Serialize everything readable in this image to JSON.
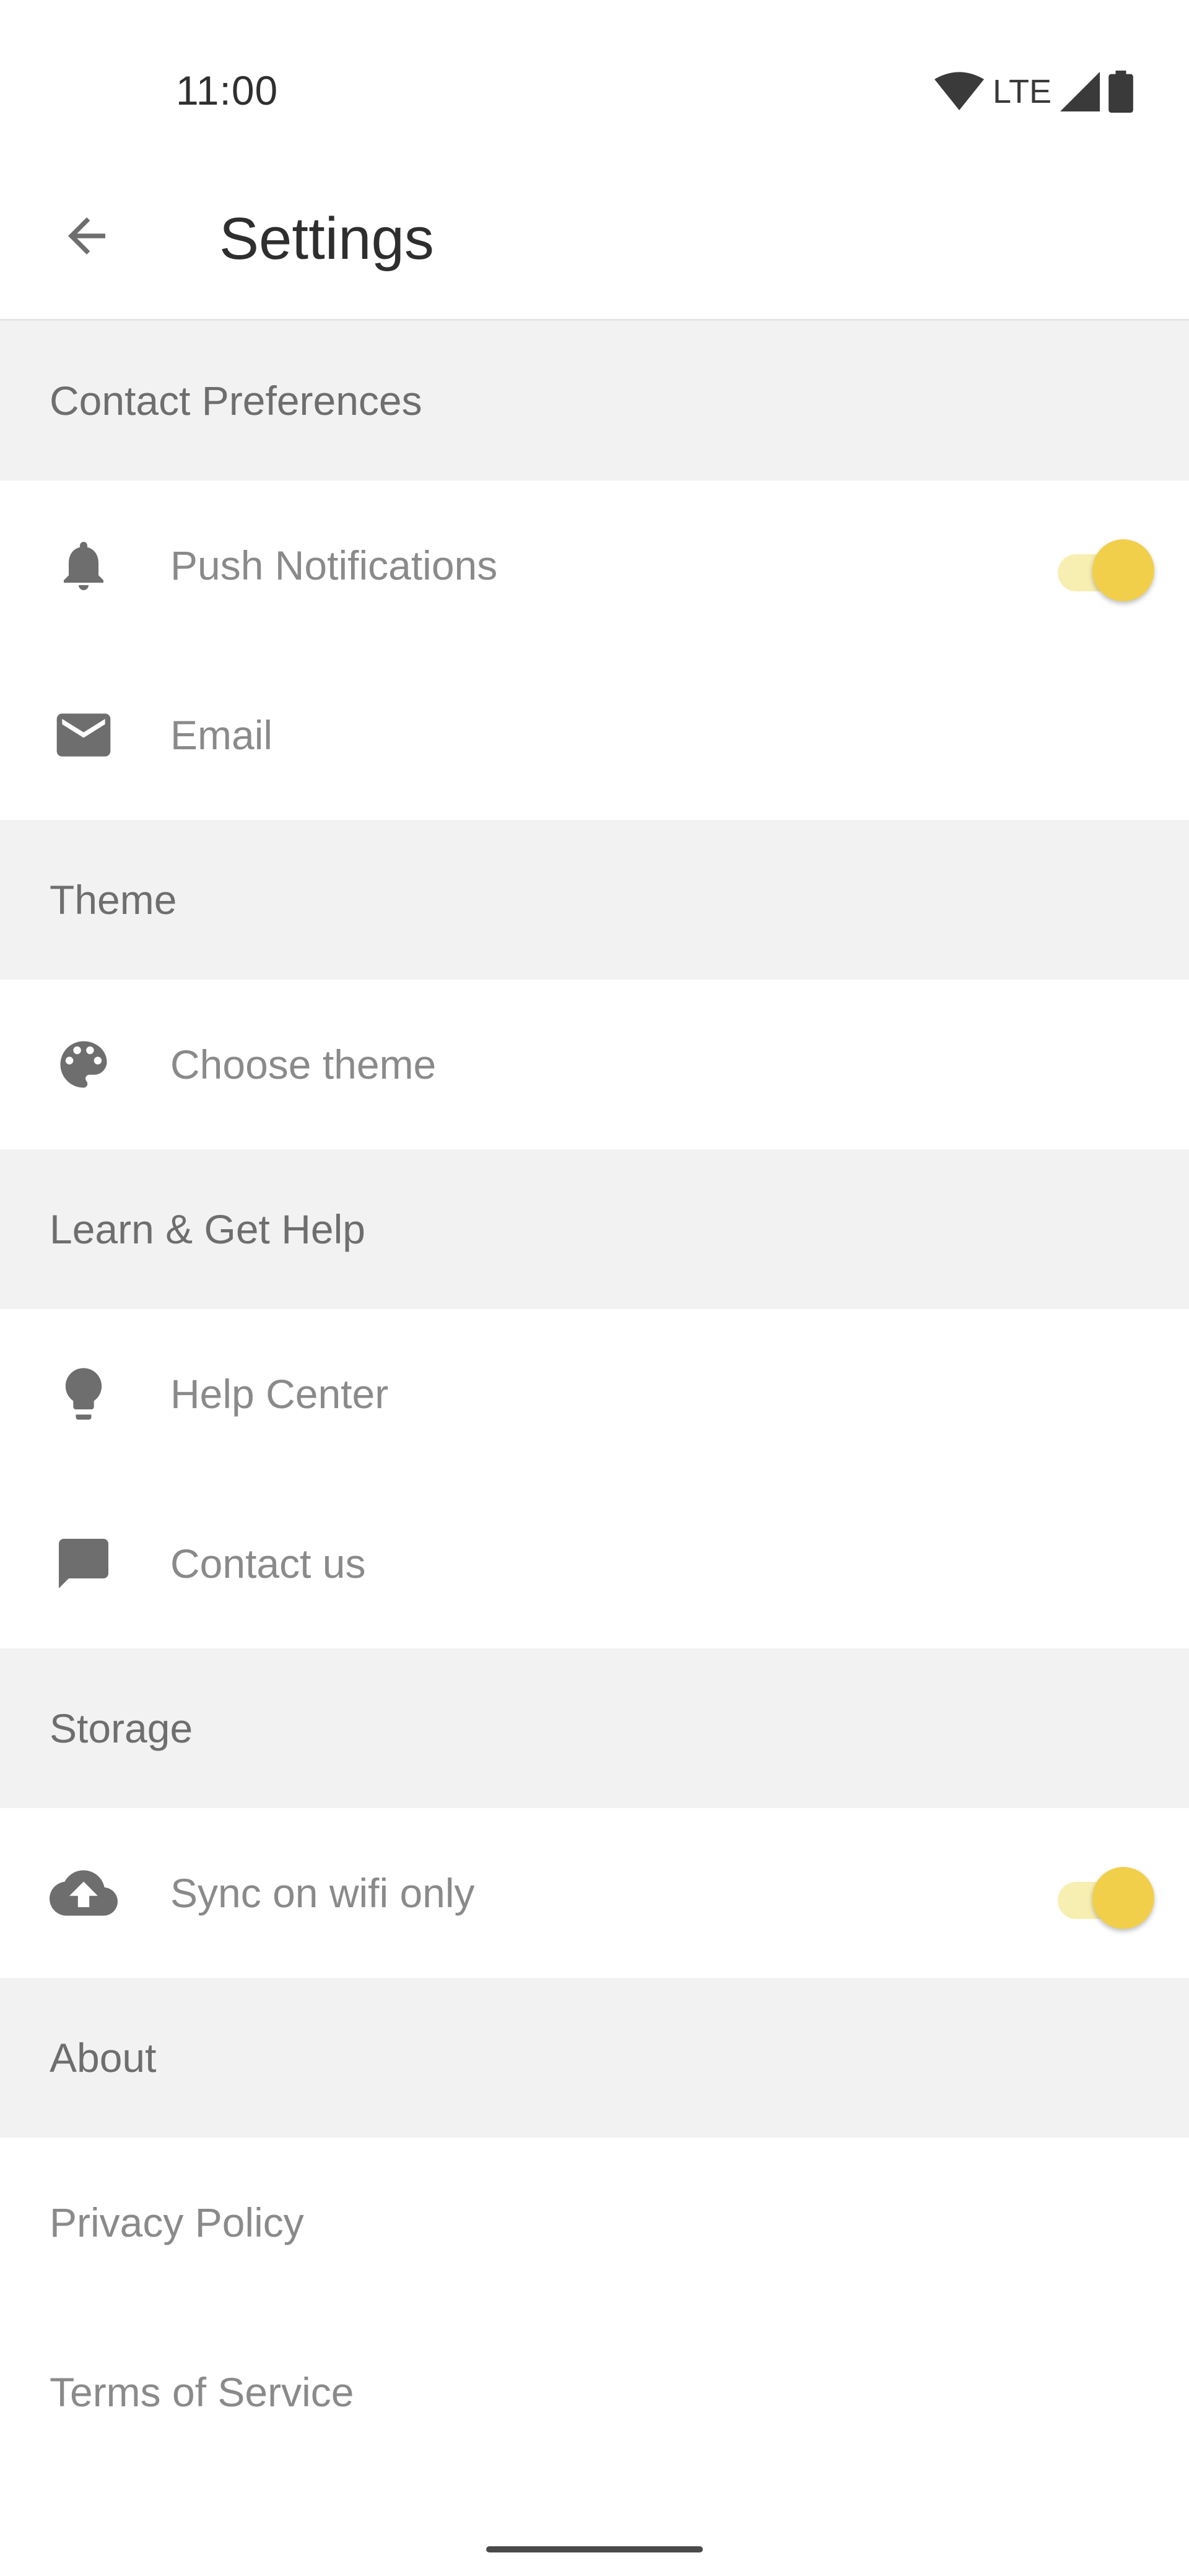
{
  "status_bar": {
    "time": "11:00",
    "network_label": "LTE"
  },
  "app_bar": {
    "title": "Settings"
  },
  "sections": {
    "contact_preferences": {
      "title": "Contact Preferences"
    },
    "theme": {
      "title": "Theme"
    },
    "learn_help": {
      "title": "Learn & Get Help"
    },
    "storage": {
      "title": "Storage"
    },
    "about": {
      "title": "About"
    }
  },
  "items": {
    "push_notifications": {
      "label": "Push Notifications",
      "enabled": true,
      "icon": "bell-icon"
    },
    "email": {
      "label": "Email",
      "icon": "mail-icon"
    },
    "choose_theme": {
      "label": "Choose theme",
      "icon": "palette-icon"
    },
    "help_center": {
      "label": "Help Center",
      "icon": "lightbulb-icon"
    },
    "contact_us": {
      "label": "Contact us",
      "icon": "chat-icon"
    },
    "sync_wifi": {
      "label": "Sync on wifi only",
      "enabled": true,
      "icon": "cloud-upload-icon"
    },
    "privacy_policy": {
      "label": "Privacy Policy"
    },
    "terms_of_service": {
      "label": "Terms of Service"
    }
  },
  "colors": {
    "accent": "#f2cf4b",
    "accent_track": "#f7eeb2",
    "section_bg": "#f2f2f2",
    "icon": "#6e6e6e"
  }
}
